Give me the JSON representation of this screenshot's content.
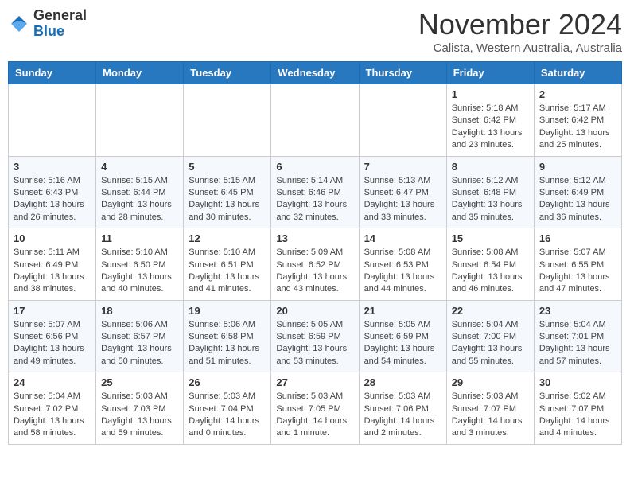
{
  "header": {
    "logo_general": "General",
    "logo_blue": "Blue",
    "month_title": "November 2024",
    "subtitle": "Calista, Western Australia, Australia"
  },
  "weekdays": [
    "Sunday",
    "Monday",
    "Tuesday",
    "Wednesday",
    "Thursday",
    "Friday",
    "Saturday"
  ],
  "weeks": [
    [
      {
        "day": "",
        "info": ""
      },
      {
        "day": "",
        "info": ""
      },
      {
        "day": "",
        "info": ""
      },
      {
        "day": "",
        "info": ""
      },
      {
        "day": "",
        "info": ""
      },
      {
        "day": "1",
        "info": "Sunrise: 5:18 AM\nSunset: 6:42 PM\nDaylight: 13 hours\nand 23 minutes."
      },
      {
        "day": "2",
        "info": "Sunrise: 5:17 AM\nSunset: 6:42 PM\nDaylight: 13 hours\nand 25 minutes."
      }
    ],
    [
      {
        "day": "3",
        "info": "Sunrise: 5:16 AM\nSunset: 6:43 PM\nDaylight: 13 hours\nand 26 minutes."
      },
      {
        "day": "4",
        "info": "Sunrise: 5:15 AM\nSunset: 6:44 PM\nDaylight: 13 hours\nand 28 minutes."
      },
      {
        "day": "5",
        "info": "Sunrise: 5:15 AM\nSunset: 6:45 PM\nDaylight: 13 hours\nand 30 minutes."
      },
      {
        "day": "6",
        "info": "Sunrise: 5:14 AM\nSunset: 6:46 PM\nDaylight: 13 hours\nand 32 minutes."
      },
      {
        "day": "7",
        "info": "Sunrise: 5:13 AM\nSunset: 6:47 PM\nDaylight: 13 hours\nand 33 minutes."
      },
      {
        "day": "8",
        "info": "Sunrise: 5:12 AM\nSunset: 6:48 PM\nDaylight: 13 hours\nand 35 minutes."
      },
      {
        "day": "9",
        "info": "Sunrise: 5:12 AM\nSunset: 6:49 PM\nDaylight: 13 hours\nand 36 minutes."
      }
    ],
    [
      {
        "day": "10",
        "info": "Sunrise: 5:11 AM\nSunset: 6:49 PM\nDaylight: 13 hours\nand 38 minutes."
      },
      {
        "day": "11",
        "info": "Sunrise: 5:10 AM\nSunset: 6:50 PM\nDaylight: 13 hours\nand 40 minutes."
      },
      {
        "day": "12",
        "info": "Sunrise: 5:10 AM\nSunset: 6:51 PM\nDaylight: 13 hours\nand 41 minutes."
      },
      {
        "day": "13",
        "info": "Sunrise: 5:09 AM\nSunset: 6:52 PM\nDaylight: 13 hours\nand 43 minutes."
      },
      {
        "day": "14",
        "info": "Sunrise: 5:08 AM\nSunset: 6:53 PM\nDaylight: 13 hours\nand 44 minutes."
      },
      {
        "day": "15",
        "info": "Sunrise: 5:08 AM\nSunset: 6:54 PM\nDaylight: 13 hours\nand 46 minutes."
      },
      {
        "day": "16",
        "info": "Sunrise: 5:07 AM\nSunset: 6:55 PM\nDaylight: 13 hours\nand 47 minutes."
      }
    ],
    [
      {
        "day": "17",
        "info": "Sunrise: 5:07 AM\nSunset: 6:56 PM\nDaylight: 13 hours\nand 49 minutes."
      },
      {
        "day": "18",
        "info": "Sunrise: 5:06 AM\nSunset: 6:57 PM\nDaylight: 13 hours\nand 50 minutes."
      },
      {
        "day": "19",
        "info": "Sunrise: 5:06 AM\nSunset: 6:58 PM\nDaylight: 13 hours\nand 51 minutes."
      },
      {
        "day": "20",
        "info": "Sunrise: 5:05 AM\nSunset: 6:59 PM\nDaylight: 13 hours\nand 53 minutes."
      },
      {
        "day": "21",
        "info": "Sunrise: 5:05 AM\nSunset: 6:59 PM\nDaylight: 13 hours\nand 54 minutes."
      },
      {
        "day": "22",
        "info": "Sunrise: 5:04 AM\nSunset: 7:00 PM\nDaylight: 13 hours\nand 55 minutes."
      },
      {
        "day": "23",
        "info": "Sunrise: 5:04 AM\nSunset: 7:01 PM\nDaylight: 13 hours\nand 57 minutes."
      }
    ],
    [
      {
        "day": "24",
        "info": "Sunrise: 5:04 AM\nSunset: 7:02 PM\nDaylight: 13 hours\nand 58 minutes."
      },
      {
        "day": "25",
        "info": "Sunrise: 5:03 AM\nSunset: 7:03 PM\nDaylight: 13 hours\nand 59 minutes."
      },
      {
        "day": "26",
        "info": "Sunrise: 5:03 AM\nSunset: 7:04 PM\nDaylight: 14 hours\nand 0 minutes."
      },
      {
        "day": "27",
        "info": "Sunrise: 5:03 AM\nSunset: 7:05 PM\nDaylight: 14 hours\nand 1 minute."
      },
      {
        "day": "28",
        "info": "Sunrise: 5:03 AM\nSunset: 7:06 PM\nDaylight: 14 hours\nand 2 minutes."
      },
      {
        "day": "29",
        "info": "Sunrise: 5:03 AM\nSunset: 7:07 PM\nDaylight: 14 hours\nand 3 minutes."
      },
      {
        "day": "30",
        "info": "Sunrise: 5:02 AM\nSunset: 7:07 PM\nDaylight: 14 hours\nand 4 minutes."
      }
    ]
  ]
}
